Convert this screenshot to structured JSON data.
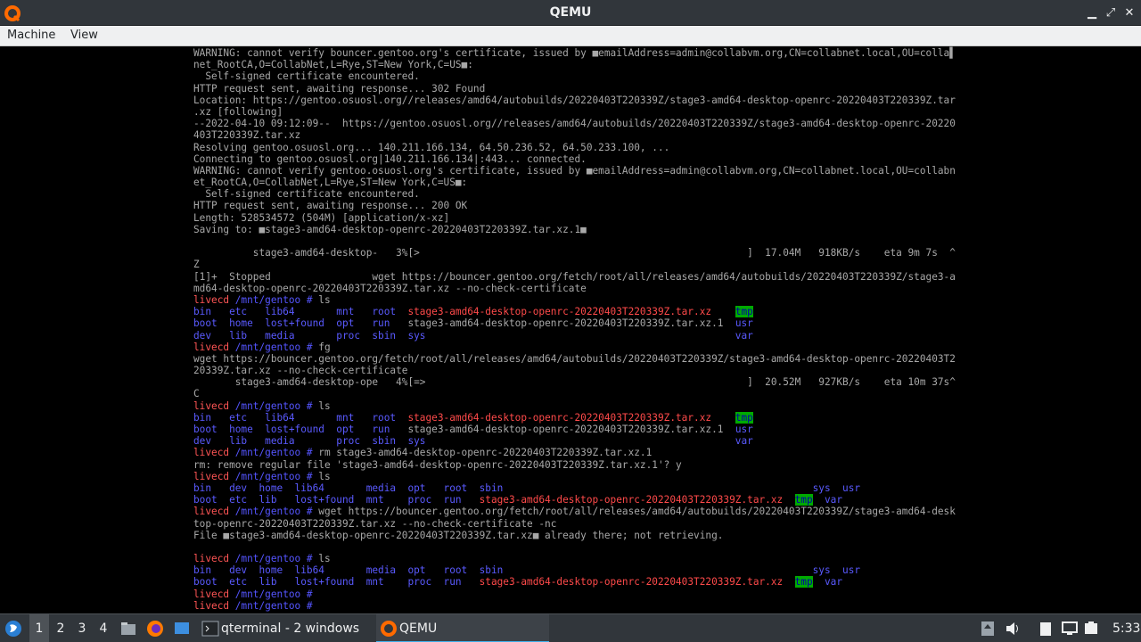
{
  "window": {
    "title": "QEMU"
  },
  "menu": [
    "Machine",
    "View"
  ],
  "terminal": [
    [
      {
        "t": "WARNING: cannot verify bouncer.gentoo.org's certificate, issued by ■emailAddress=admin@collabvm.org,CN=collabnet.local,OU=colla▌"
      }
    ],
    [
      {
        "t": "net_RootCA,O=CollabNet,L=Rye,ST=New York,C=US■:"
      }
    ],
    [
      {
        "t": "  Self-signed certificate encountered."
      }
    ],
    [
      {
        "t": "HTTP request sent, awaiting response... 302 Found"
      }
    ],
    [
      {
        "t": "Location: https://gentoo.osuosl.org//releases/amd64/autobuilds/20220403T220339Z/stage3-amd64-desktop-openrc-20220403T220339Z.tar"
      }
    ],
    [
      {
        "t": ".xz [following]"
      }
    ],
    [
      {
        "t": "--2022-04-10 09:12:09--  https://gentoo.osuosl.org//releases/amd64/autobuilds/20220403T220339Z/stage3-amd64-desktop-openrc-20220"
      }
    ],
    [
      {
        "t": "403T220339Z.tar.xz"
      }
    ],
    [
      {
        "t": "Resolving gentoo.osuosl.org... 140.211.166.134, 64.50.236.52, 64.50.233.100, ..."
      }
    ],
    [
      {
        "t": "Connecting to gentoo.osuosl.org|140.211.166.134|:443... connected."
      }
    ],
    [
      {
        "t": "WARNING: cannot verify gentoo.osuosl.org's certificate, issued by ■emailAddress=admin@collabvm.org,CN=collabnet.local,OU=collabn"
      }
    ],
    [
      {
        "t": "et_RootCA,O=CollabNet,L=Rye,ST=New York,C=US■:"
      }
    ],
    [
      {
        "t": "  Self-signed certificate encountered."
      }
    ],
    [
      {
        "t": "HTTP request sent, awaiting response... 200 OK"
      }
    ],
    [
      {
        "t": "Length: 528534572 (504M) [application/x-xz]"
      }
    ],
    [
      {
        "t": "Saving to: ■stage3-amd64-desktop-openrc-20220403T220339Z.tar.xz.1■"
      }
    ],
    [
      {
        "t": ""
      }
    ],
    [
      {
        "t": "          stage3-amd64-desktop-   3%[>                                                       ]  17.04M   918KB/s    eta 9m 7s  ^"
      }
    ],
    [
      {
        "t": "Z"
      }
    ],
    [
      {
        "t": "[1]+  Stopped                 wget https://bouncer.gentoo.org/fetch/root/all/releases/amd64/autobuilds/20220403T220339Z/stage3-a"
      }
    ],
    [
      {
        "t": "md64-desktop-openrc-20220403T220339Z.tar.xz --no-check-certificate"
      }
    ],
    [
      {
        "t": "livecd",
        "c": "prompt-user"
      },
      {
        "t": " /mnt/gentoo # ",
        "c": "prompt-path"
      },
      {
        "t": "ls"
      }
    ],
    [
      {
        "t": "bin   etc   lib64       mnt   root  ",
        "c": "c-blue"
      },
      {
        "t": "stage3-amd64-desktop-openrc-20220403T220339Z.tar.xz",
        "c": "c-red"
      },
      {
        "t": "    "
      },
      {
        "t": "tmp",
        "c": "c-tmp"
      }
    ],
    [
      {
        "t": "boot  home  lost+found  opt   run   ",
        "c": "c-blue"
      },
      {
        "t": "stage3-amd64-desktop-openrc-20220403T220339Z.tar.xz.1  "
      },
      {
        "t": "usr",
        "c": "c-blue"
      }
    ],
    [
      {
        "t": "dev   lib   media       proc  sbin  sys",
        "c": "c-blue"
      },
      {
        "t": "                                                    "
      },
      {
        "t": "var",
        "c": "c-blue"
      }
    ],
    [
      {
        "t": "livecd",
        "c": "prompt-user"
      },
      {
        "t": " /mnt/gentoo # ",
        "c": "prompt-path"
      },
      {
        "t": "fg"
      }
    ],
    [
      {
        "t": "wget https://bouncer.gentoo.org/fetch/root/all/releases/amd64/autobuilds/20220403T220339Z/stage3-amd64-desktop-openrc-20220403T2"
      }
    ],
    [
      {
        "t": "20339Z.tar.xz --no-check-certificate"
      }
    ],
    [
      {
        "t": "       stage3-amd64-desktop-ope   4%[=>                                                      ]  20.52M   927KB/s    eta 10m 37s^"
      }
    ],
    [
      {
        "t": "C"
      }
    ],
    [
      {
        "t": "livecd",
        "c": "prompt-user"
      },
      {
        "t": " /mnt/gentoo # ",
        "c": "prompt-path"
      },
      {
        "t": "ls"
      }
    ],
    [
      {
        "t": "bin   etc   lib64       mnt   root  ",
        "c": "c-blue"
      },
      {
        "t": "stage3-amd64-desktop-openrc-20220403T220339Z.tar.xz",
        "c": "c-red"
      },
      {
        "t": "    "
      },
      {
        "t": "tmp",
        "c": "c-tmp"
      }
    ],
    [
      {
        "t": "boot  home  lost+found  opt   run   ",
        "c": "c-blue"
      },
      {
        "t": "stage3-amd64-desktop-openrc-20220403T220339Z.tar.xz.1  "
      },
      {
        "t": "usr",
        "c": "c-blue"
      }
    ],
    [
      {
        "t": "dev   lib   media       proc  sbin  sys",
        "c": "c-blue"
      },
      {
        "t": "                                                    "
      },
      {
        "t": "var",
        "c": "c-blue"
      }
    ],
    [
      {
        "t": "livecd",
        "c": "prompt-user"
      },
      {
        "t": " /mnt/gentoo # ",
        "c": "prompt-path"
      },
      {
        "t": "rm stage3-amd64-desktop-openrc-20220403T220339Z.tar.xz.1"
      }
    ],
    [
      {
        "t": "rm: remove regular file 'stage3-amd64-desktop-openrc-20220403T220339Z.tar.xz.1'? y"
      }
    ],
    [
      {
        "t": "livecd",
        "c": "prompt-user"
      },
      {
        "t": " /mnt/gentoo # ",
        "c": "prompt-path"
      },
      {
        "t": "ls"
      }
    ],
    [
      {
        "t": "bin   dev  home  lib64       media  opt   root  sbin",
        "c": "c-blue"
      },
      {
        "t": "                                                    "
      },
      {
        "t": "sys  usr",
        "c": "c-blue"
      }
    ],
    [
      {
        "t": "boot  etc  lib   lost+found  mnt    proc  run   ",
        "c": "c-blue"
      },
      {
        "t": "stage3-amd64-desktop-openrc-20220403T220339Z.tar.xz",
        "c": "c-red"
      },
      {
        "t": "  "
      },
      {
        "t": "tmp",
        "c": "c-tmp"
      },
      {
        "t": "  "
      },
      {
        "t": "var",
        "c": "c-blue"
      }
    ],
    [
      {
        "t": "livecd",
        "c": "prompt-user"
      },
      {
        "t": " /mnt/gentoo # ",
        "c": "prompt-path"
      },
      {
        "t": "wget https://bouncer.gentoo.org/fetch/root/all/releases/amd64/autobuilds/20220403T220339Z/stage3-amd64-desk"
      }
    ],
    [
      {
        "t": "top-openrc-20220403T220339Z.tar.xz --no-check-certificate -nc"
      }
    ],
    [
      {
        "t": "File ■stage3-amd64-desktop-openrc-20220403T220339Z.tar.xz■ already there; not retrieving."
      }
    ],
    [
      {
        "t": ""
      }
    ],
    [
      {
        "t": "livecd",
        "c": "prompt-user"
      },
      {
        "t": " /mnt/gentoo # ",
        "c": "prompt-path"
      },
      {
        "t": "ls"
      }
    ],
    [
      {
        "t": "bin   dev  home  lib64       media  opt   root  sbin",
        "c": "c-blue"
      },
      {
        "t": "                                                    "
      },
      {
        "t": "sys  usr",
        "c": "c-blue"
      }
    ],
    [
      {
        "t": "boot  etc  lib   lost+found  mnt    proc  run   ",
        "c": "c-blue"
      },
      {
        "t": "stage3-amd64-desktop-openrc-20220403T220339Z.tar.xz",
        "c": "c-red"
      },
      {
        "t": "  "
      },
      {
        "t": "tmp",
        "c": "c-tmp"
      },
      {
        "t": "  "
      },
      {
        "t": "var",
        "c": "c-blue"
      }
    ],
    [
      {
        "t": "livecd",
        "c": "prompt-user"
      },
      {
        "t": " /mnt/gentoo # ",
        "c": "prompt-path"
      }
    ],
    [
      {
        "t": "livecd",
        "c": "prompt-user"
      },
      {
        "t": " /mnt/gentoo # ",
        "c": "prompt-path"
      }
    ]
  ],
  "taskbar": {
    "desktops": [
      "1",
      "2",
      "3",
      "4"
    ],
    "active_desktop": "1",
    "tasks": [
      {
        "label": "qterminal - 2 windows",
        "icon": "terminal-icon"
      },
      {
        "label": "QEMU",
        "icon": "qemu-icon"
      }
    ],
    "clock": "5:33",
    "accent_color": "#3daee9"
  }
}
